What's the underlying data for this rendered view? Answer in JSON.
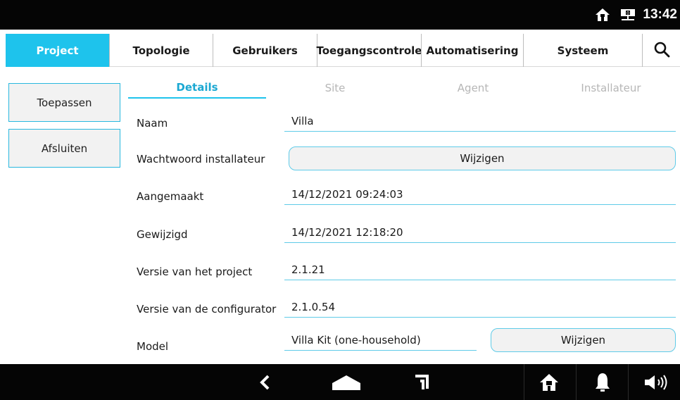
{
  "status_bar": {
    "time": "13:42",
    "icons": [
      "home-icon",
      "network-icon"
    ]
  },
  "nav": {
    "tabs": [
      {
        "label": "Project",
        "active": true
      },
      {
        "label": "Topologie",
        "active": false
      },
      {
        "label": "Gebruikers",
        "active": false
      },
      {
        "label": "Toegangscontrole",
        "active": false
      },
      {
        "label": "Automatisering",
        "active": false
      },
      {
        "label": "Systeem",
        "active": false
      }
    ],
    "search_icon": "search-icon"
  },
  "side": {
    "apply_label": "Toepassen",
    "close_label": "Afsluiten"
  },
  "subtabs": [
    {
      "label": "Details",
      "active": true
    },
    {
      "label": "Site",
      "active": false
    },
    {
      "label": "Agent",
      "active": false
    },
    {
      "label": "Installateur",
      "active": false
    }
  ],
  "form": {
    "name_label": "Naam",
    "name_value": "Villa",
    "password_label": "Wachtwoord installateur",
    "password_button": "Wijzigen",
    "created_label": "Aangemaakt",
    "created_value": "14/12/2021 09:24:03",
    "modified_label": "Gewijzigd",
    "modified_value": "14/12/2021 12:18:20",
    "project_version_label": "Versie van het project",
    "project_version_value": "2.1.21",
    "configurator_version_label": "Versie van de configurator",
    "configurator_version_value": "2.1.0.54",
    "model_label": "Model",
    "model_value": "Villa Kit (one-household)",
    "model_button": "Wijzigen"
  },
  "bottom_bar": {
    "icons": [
      "back-icon",
      "home-icon",
      "recent-apps-icon",
      "house-icon",
      "bell-icon",
      "volume-icon"
    ]
  },
  "colors": {
    "accent": "#1ec3ec",
    "bar": "#050505"
  }
}
